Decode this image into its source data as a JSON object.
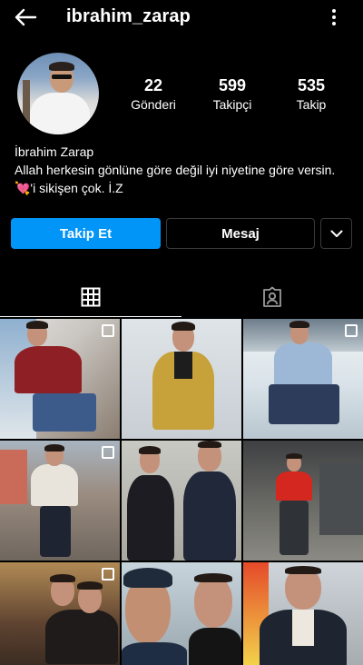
{
  "header": {
    "username": "ibrahim_zarap",
    "back_icon": "arrow-left-icon",
    "more_icon": "more-vertical-icon"
  },
  "profile": {
    "name": "İbrahim Zarap",
    "bio_line1": "Allah herkesin gönlüne göre değil iyi niyetine göre versin.",
    "bio_line2": "💘'i sikişen çok. İ.Z"
  },
  "stats": {
    "posts": {
      "value": "22",
      "label": "Gönderi"
    },
    "followers": {
      "value": "599",
      "label": "Takipçi"
    },
    "following": {
      "value": "535",
      "label": "Takip"
    }
  },
  "actions": {
    "follow_label": "Takip Et",
    "message_label": "Mesaj",
    "dropdown_icon": "chevron-down-icon"
  },
  "tabs": [
    {
      "icon": "grid-icon",
      "active": true
    },
    {
      "icon": "tagged-person-icon",
      "active": false
    }
  ],
  "colors": {
    "background": "#000000",
    "follow_button": "#0095f6",
    "border": "#3a3a3a"
  },
  "posts": [
    {
      "multiple": true
    },
    {
      "multiple": false
    },
    {
      "multiple": true
    },
    {
      "multiple": true
    },
    {
      "multiple": false
    },
    {
      "multiple": false
    },
    {
      "multiple": true
    },
    {
      "multiple": false
    },
    {
      "multiple": false
    }
  ]
}
